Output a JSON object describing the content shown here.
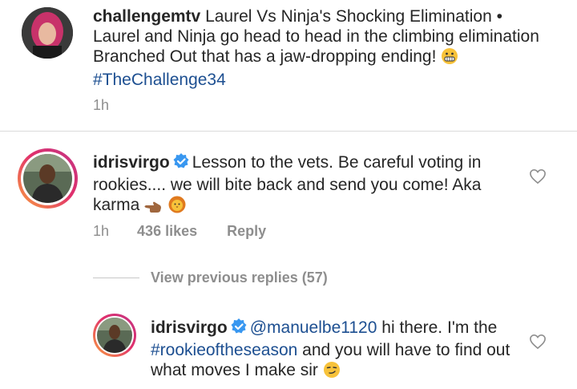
{
  "post": {
    "username": "challengemtv",
    "caption": "Laurel Vs Ninja's Shocking Elimination • Laurel and Ninja go head to head in the climbing elimination Branched Out that has a jaw-dropping ending!",
    "hashtag": "#TheChallenge34",
    "time": "1h"
  },
  "comment": {
    "username": "idrisvirgo",
    "text": "Lesson to the vets. Be careful voting in rookies.... we will bite back and send you come! Aka karma",
    "time": "1h",
    "likes": "436 likes",
    "reply": "Reply"
  },
  "view_replies": "View previous replies (57)",
  "reply": {
    "username": "idrisvirgo",
    "mention": "@manuelbe1120",
    "text_a": "hi there. I'm the",
    "hashtag": "#rookieoftheseason",
    "text_b": "and you will have to find out what moves I make sir"
  },
  "colors": {
    "link": "#1d4f91",
    "meta": "#8e8e8e",
    "verified": "#3897f0"
  },
  "icons": [
    "avatar-challengemtv",
    "verified-badge-icon",
    "heart-icon",
    "pointing-hand-emoji",
    "lion-emoji",
    "grimace-emoji",
    "smirk-emoji"
  ]
}
